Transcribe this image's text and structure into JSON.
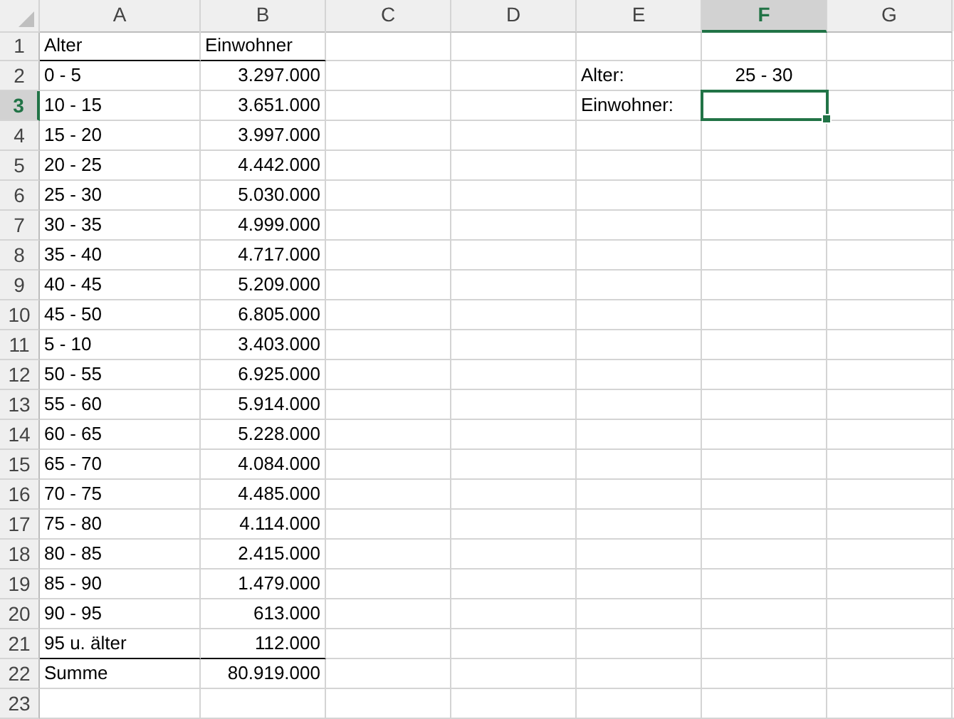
{
  "columns": [
    {
      "label": "A",
      "selected": false
    },
    {
      "label": "B",
      "selected": false
    },
    {
      "label": "C",
      "selected": false
    },
    {
      "label": "D",
      "selected": false
    },
    {
      "label": "E",
      "selected": false
    },
    {
      "label": "F",
      "selected": true
    },
    {
      "label": "G",
      "selected": false
    }
  ],
  "rows": [
    {
      "label": "1",
      "selected": false,
      "kind": "header",
      "alter": "Alter",
      "einwohner": "Einwohner"
    },
    {
      "label": "2",
      "selected": false,
      "kind": "data",
      "alter": "0 - 5",
      "einwohner": "3.297.000"
    },
    {
      "label": "3",
      "selected": true,
      "kind": "data",
      "alter": "10 - 15",
      "einwohner": "3.651.000"
    },
    {
      "label": "4",
      "selected": false,
      "kind": "data",
      "alter": "15 - 20",
      "einwohner": "3.997.000"
    },
    {
      "label": "5",
      "selected": false,
      "kind": "data",
      "alter": "20 - 25",
      "einwohner": "4.442.000"
    },
    {
      "label": "6",
      "selected": false,
      "kind": "data",
      "alter": "25 - 30",
      "einwohner": "5.030.000"
    },
    {
      "label": "7",
      "selected": false,
      "kind": "data",
      "alter": "30 - 35",
      "einwohner": "4.999.000"
    },
    {
      "label": "8",
      "selected": false,
      "kind": "data",
      "alter": "35 - 40",
      "einwohner": "4.717.000"
    },
    {
      "label": "9",
      "selected": false,
      "kind": "data",
      "alter": "40 - 45",
      "einwohner": "5.209.000"
    },
    {
      "label": "10",
      "selected": false,
      "kind": "data",
      "alter": "45 - 50",
      "einwohner": "6.805.000"
    },
    {
      "label": "11",
      "selected": false,
      "kind": "data",
      "alter": "5 - 10",
      "einwohner": "3.403.000"
    },
    {
      "label": "12",
      "selected": false,
      "kind": "data",
      "alter": "50 - 55",
      "einwohner": "6.925.000"
    },
    {
      "label": "13",
      "selected": false,
      "kind": "data",
      "alter": "55 - 60",
      "einwohner": "5.914.000"
    },
    {
      "label": "14",
      "selected": false,
      "kind": "data",
      "alter": "60 - 65",
      "einwohner": "5.228.000"
    },
    {
      "label": "15",
      "selected": false,
      "kind": "data",
      "alter": "65 - 70",
      "einwohner": "4.084.000"
    },
    {
      "label": "16",
      "selected": false,
      "kind": "data",
      "alter": "70 - 75",
      "einwohner": "4.485.000"
    },
    {
      "label": "17",
      "selected": false,
      "kind": "data",
      "alter": "75 - 80",
      "einwohner": "4.114.000"
    },
    {
      "label": "18",
      "selected": false,
      "kind": "data",
      "alter": "80 - 85",
      "einwohner": "2.415.000"
    },
    {
      "label": "19",
      "selected": false,
      "kind": "data",
      "alter": "85 - 90",
      "einwohner": "1.479.000"
    },
    {
      "label": "20",
      "selected": false,
      "kind": "data",
      "alter": "90 - 95",
      "einwohner": "613.000"
    },
    {
      "label": "21",
      "selected": false,
      "kind": "data",
      "alter": "95 u. älter",
      "einwohner": "112.000"
    },
    {
      "label": "22",
      "selected": false,
      "kind": "total",
      "alter": "Summe",
      "einwohner": "80.919.000"
    },
    {
      "label": "23",
      "selected": false,
      "kind": "empty"
    }
  ],
  "lookup": {
    "alter_label": "Alter:",
    "alter_value": "25 - 30",
    "einwohner_label": "Einwohner:"
  }
}
